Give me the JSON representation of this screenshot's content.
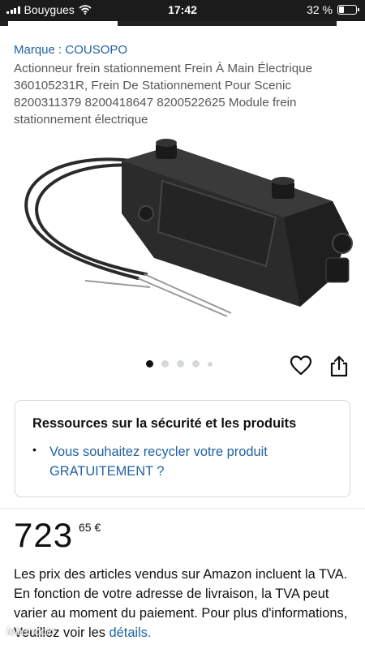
{
  "status_bar": {
    "carrier": "Bouygues",
    "time": "17:42",
    "battery": "32 %",
    "battery_level": 0.32
  },
  "product": {
    "brand": "Marque : COUSOPO",
    "title": "Actionneur frein stationnement Frein À Main Électrique 360105231R, Frein De Stationnement Pour Scenic 8200311379 8200418647 8200522625 Module frein stationnement électrique",
    "image_icon": "electric-parking-brake-actuator-photo",
    "carousel": {
      "total": 5,
      "current": 1
    }
  },
  "actions": {
    "wishlist_icon": "heart-icon",
    "share_icon": "share-icon"
  },
  "safety_card": {
    "title": "Ressources sur la sécurité et les produits",
    "bullet": "•",
    "link": "Vous souhaitez recycler votre produit GRATUITEMENT ?"
  },
  "price": {
    "whole": "723",
    "fraction": "65 €"
  },
  "vat_notice": {
    "text": "Les prix des articles vendus sur Amazon incluent la TVA. En fonction de votre adresse de livraison, la TVA peut varier au moment du paiement. Pour plus d'informations, Veuillez voir les ",
    "link": "détails."
  },
  "watermark": "leboncoin",
  "colors": {
    "link": "#2162a1",
    "text": "#0f1111",
    "muted": "#565959",
    "border": "#d5d9d9"
  }
}
